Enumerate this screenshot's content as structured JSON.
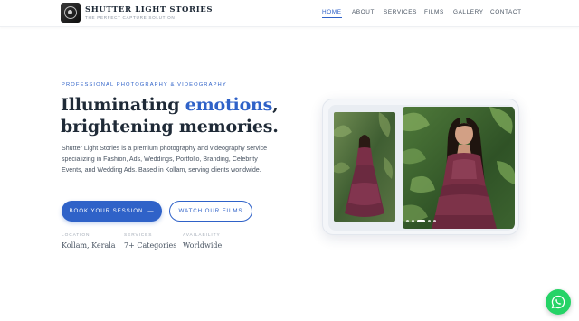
{
  "brand": {
    "title": "SHUTTER LIGHT STORIES",
    "tagline": "THE PERFECT CAPTURE SOLUTION",
    "logo_icon": "camera-aperture-icon"
  },
  "nav": {
    "items": [
      {
        "label": "HOME",
        "active": true
      },
      {
        "label": "ABOUT",
        "active": false
      },
      {
        "label": "SERVICES",
        "active": false
      },
      {
        "label": "FILMS",
        "active": false
      },
      {
        "label": "GALLERY",
        "active": false
      },
      {
        "label": "CONTACT",
        "active": false
      }
    ]
  },
  "hero": {
    "eyebrow": "PROFESSIONAL PHOTOGRAPHY & VIDEOGRAPHY",
    "headline_part1": "Illuminating ",
    "headline_accent": "emotions",
    "headline_part2": ",",
    "headline_line2": "brightening memories.",
    "description": "Shutter Light Stories is a premium photography and videography service specializing in Fashion, Ads, Weddings, Portfolio, Branding, Celebrity Events, and Wedding Ads. Based in Kollam, serving clients worldwide.",
    "primary_button": "BOOK YOUR SESSION",
    "primary_button_arrow": "—",
    "secondary_button": "WATCH OUR FILMS"
  },
  "stats": [
    {
      "label": "LOCATION",
      "value": "Kollam, Kerala"
    },
    {
      "label": "SERVICES",
      "value": "7+ Categories"
    },
    {
      "label": "AVAILABILITY",
      "value": "Worldwide"
    }
  ],
  "gallery": {
    "slide_count": 5,
    "active_slide": 3
  },
  "colors": {
    "accent": "#2f62c8",
    "text_dark": "#1f2a37",
    "text_muted": "#4a5563",
    "whatsapp": "#25d366"
  },
  "floating": {
    "whatsapp_icon": "whatsapp-icon"
  }
}
